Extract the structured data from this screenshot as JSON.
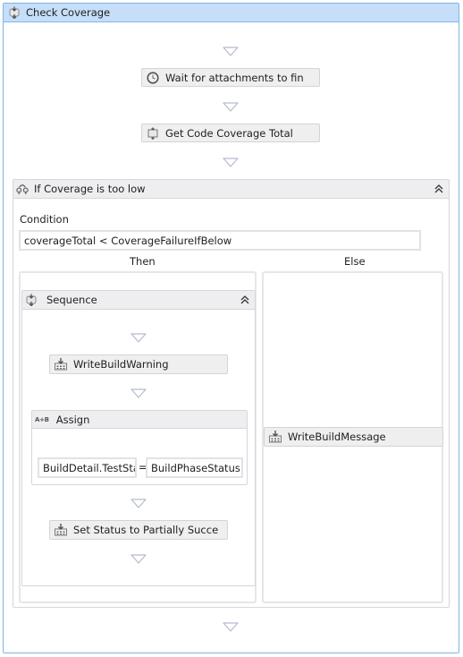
{
  "outer": {
    "title": "Check Coverage",
    "icon": "sequence-icon"
  },
  "activities": {
    "wait": {
      "label": "Wait for attachments to fin",
      "icon": "clock-icon"
    },
    "get_coverage": {
      "label": "Get Code Coverage Total",
      "icon": "invoke-method-icon"
    }
  },
  "if_block": {
    "title": "If Coverage is too low",
    "icon": "if-icon",
    "condition_label": "Condition",
    "condition_value": "coverageTotal < CoverageFailureIfBelow",
    "then_label": "Then",
    "else_label": "Else",
    "collapse_icon": "double-chevron-up-icon"
  },
  "then_sequence": {
    "title": "Sequence",
    "icon": "sequence-icon",
    "collapse_icon": "double-chevron-up-icon",
    "write_warning": {
      "label": "WriteBuildWarning",
      "icon": "build-activity-icon"
    },
    "assign": {
      "title": "Assign",
      "icon_text": "A+B",
      "to_value": "BuildDetail.TestSta",
      "operator": "=",
      "value": "BuildPhaseStatus.F"
    },
    "set_status": {
      "label": "Set Status to Partially Succe",
      "icon": "build-activity-icon"
    }
  },
  "else_branch": {
    "write_message": {
      "label": "WriteBuildMessage",
      "icon": "build-activity-icon"
    }
  }
}
